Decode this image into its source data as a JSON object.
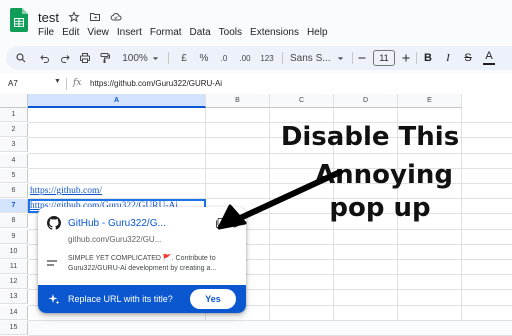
{
  "doc": {
    "title": "test"
  },
  "menu": [
    "File",
    "Edit",
    "View",
    "Insert",
    "Format",
    "Data",
    "Tools",
    "Extensions",
    "Help"
  ],
  "toolbar": {
    "zoom": "100%",
    "currency": "£",
    "percent": "%",
    "decrease_decimal": ".0",
    "increase_decimal": ".00",
    "more_formats": "123",
    "font_family": "Sans S...",
    "font_size": "11",
    "bold": "B",
    "italic": "I",
    "strikethrough": "S",
    "text_color": "A"
  },
  "formula_bar": {
    "cell_ref": "A7",
    "fx": "fx",
    "value": "https://github.com/Guru322/GURU-Ai"
  },
  "grid": {
    "columns": [
      "A",
      "B",
      "C",
      "D",
      "E"
    ],
    "selected_column": "A",
    "rows": [
      "1",
      "2",
      "3",
      "4",
      "5",
      "6",
      "7",
      "8",
      "9",
      "10",
      "11",
      "12",
      "13",
      "14",
      "15"
    ],
    "selected_row": "7",
    "cells": {
      "A6": "https://github.com/",
      "A7": "https://github.com/Guru322/GURU-Ai"
    }
  },
  "annotation": {
    "line1": "Disable This",
    "line2": "Annoying",
    "line3": "pop up"
  },
  "popup": {
    "title": "GitHub - Guru322/G...",
    "url": "github.com/Guru322/GU...",
    "description": "SIMPLE YET COMPLICATED 🚩. Contribute to Guru322/GURU-Ai development by creating a...",
    "replace_prompt": "Replace URL with its title?",
    "yes_label": "Yes"
  },
  "colors": {
    "accent": "#0b57d0",
    "link": "#1155cc",
    "sheets_green": "#0f9d58",
    "toolbar_bg": "#edf2fa"
  }
}
